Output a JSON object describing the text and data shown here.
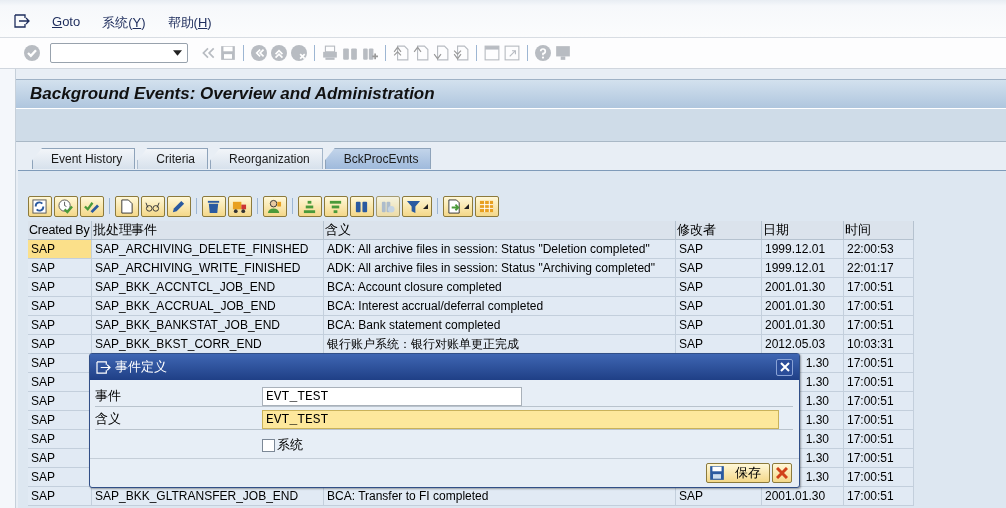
{
  "menu": [
    {
      "key": "G",
      "after": "oto"
    },
    {
      "before": "系统(",
      "key": "Y",
      "after": ")"
    },
    {
      "before": "帮助(",
      "key": "H",
      "after": ")"
    }
  ],
  "title": "Background Events: Overview and Administration",
  "tabs": [
    {
      "label": "Event History",
      "selected": false
    },
    {
      "label": "Criteria",
      "selected": false
    },
    {
      "label": "Reorganization",
      "selected": false
    },
    {
      "label": "BckProcEvnts",
      "selected": true
    }
  ],
  "table": {
    "columns": [
      "Created By",
      "批处理事件",
      "含义",
      "修改者",
      "日期",
      "时间"
    ],
    "rows": [
      {
        "created_by": "SAP",
        "event": "SAP_ARCHIVING_DELETE_FINISHED",
        "meaning": "ADK: All archive files in session: Status \"Deletion completed\"",
        "changed_by": "SAP",
        "date": "1999.12.01",
        "time": "22:00:53",
        "focused": true
      },
      {
        "created_by": "SAP",
        "event": "SAP_ARCHIVING_WRITE_FINISHED",
        "meaning": "ADK: All archive files in session: Status \"Archiving completed\"",
        "changed_by": "SAP",
        "date": "1999.12.01",
        "time": "22:01:17",
        "focused": false
      },
      {
        "created_by": "SAP",
        "event": "SAP_BKK_ACCNTCL_JOB_END",
        "meaning": "BCA: Account closure completed",
        "changed_by": "SAP",
        "date": "2001.01.30",
        "time": "17:00:51",
        "focused": false
      },
      {
        "created_by": "SAP",
        "event": "SAP_BKK_ACCRUAL_JOB_END",
        "meaning": "BCA: Interest accrual/deferral completed",
        "changed_by": "SAP",
        "date": "2001.01.30",
        "time": "17:00:51",
        "focused": false
      },
      {
        "created_by": "SAP",
        "event": "SAP_BKK_BANKSTAT_JOB_END",
        "meaning": "BCA: Bank statement completed",
        "changed_by": "SAP",
        "date": "2001.01.30",
        "time": "17:00:51",
        "focused": false
      },
      {
        "created_by": "SAP",
        "event": "SAP_BKK_BKST_CORR_END",
        "meaning": "银行账户系统：银行对账单更正完成",
        "changed_by": "SAP",
        "date": "2012.05.03",
        "time": "10:03:31",
        "focused": false
      },
      {
        "created_by": "SAP",
        "date": "1.30",
        "time": "17:00:51",
        "focused": false
      },
      {
        "created_by": "SAP",
        "date": "1.30",
        "time": "17:00:51",
        "focused": false
      },
      {
        "created_by": "SAP",
        "date": "1.30",
        "time": "17:00:51",
        "focused": false
      },
      {
        "created_by": "SAP",
        "date": "1.30",
        "time": "17:00:51",
        "focused": false
      },
      {
        "created_by": "SAP",
        "date": "1.30",
        "time": "17:00:51",
        "focused": false
      },
      {
        "created_by": "SAP",
        "date": "1.30",
        "time": "17:00:51",
        "focused": false
      },
      {
        "created_by": "SAP",
        "date": "1.30",
        "time": "17:00:51",
        "focused": false
      },
      {
        "created_by": "SAP",
        "event": "SAP_BKK_GLTRANSFER_JOB_END",
        "meaning": "BCA: Transfer to FI completed",
        "changed_by": "SAP",
        "date": "2001.01.30",
        "time": "17:00:51",
        "focused": false
      }
    ]
  },
  "dialog": {
    "title": "事件定义",
    "fields": [
      {
        "label": "事件",
        "value": "EVT_TEST",
        "focused": false
      },
      {
        "label": "含义",
        "value": "EVT_TEST",
        "focused": true
      }
    ],
    "checkbox": {
      "label": "系统",
      "checked": false
    },
    "buttons": [
      {
        "kind": "save",
        "label": "保存"
      },
      {
        "kind": "cancel"
      }
    ]
  }
}
